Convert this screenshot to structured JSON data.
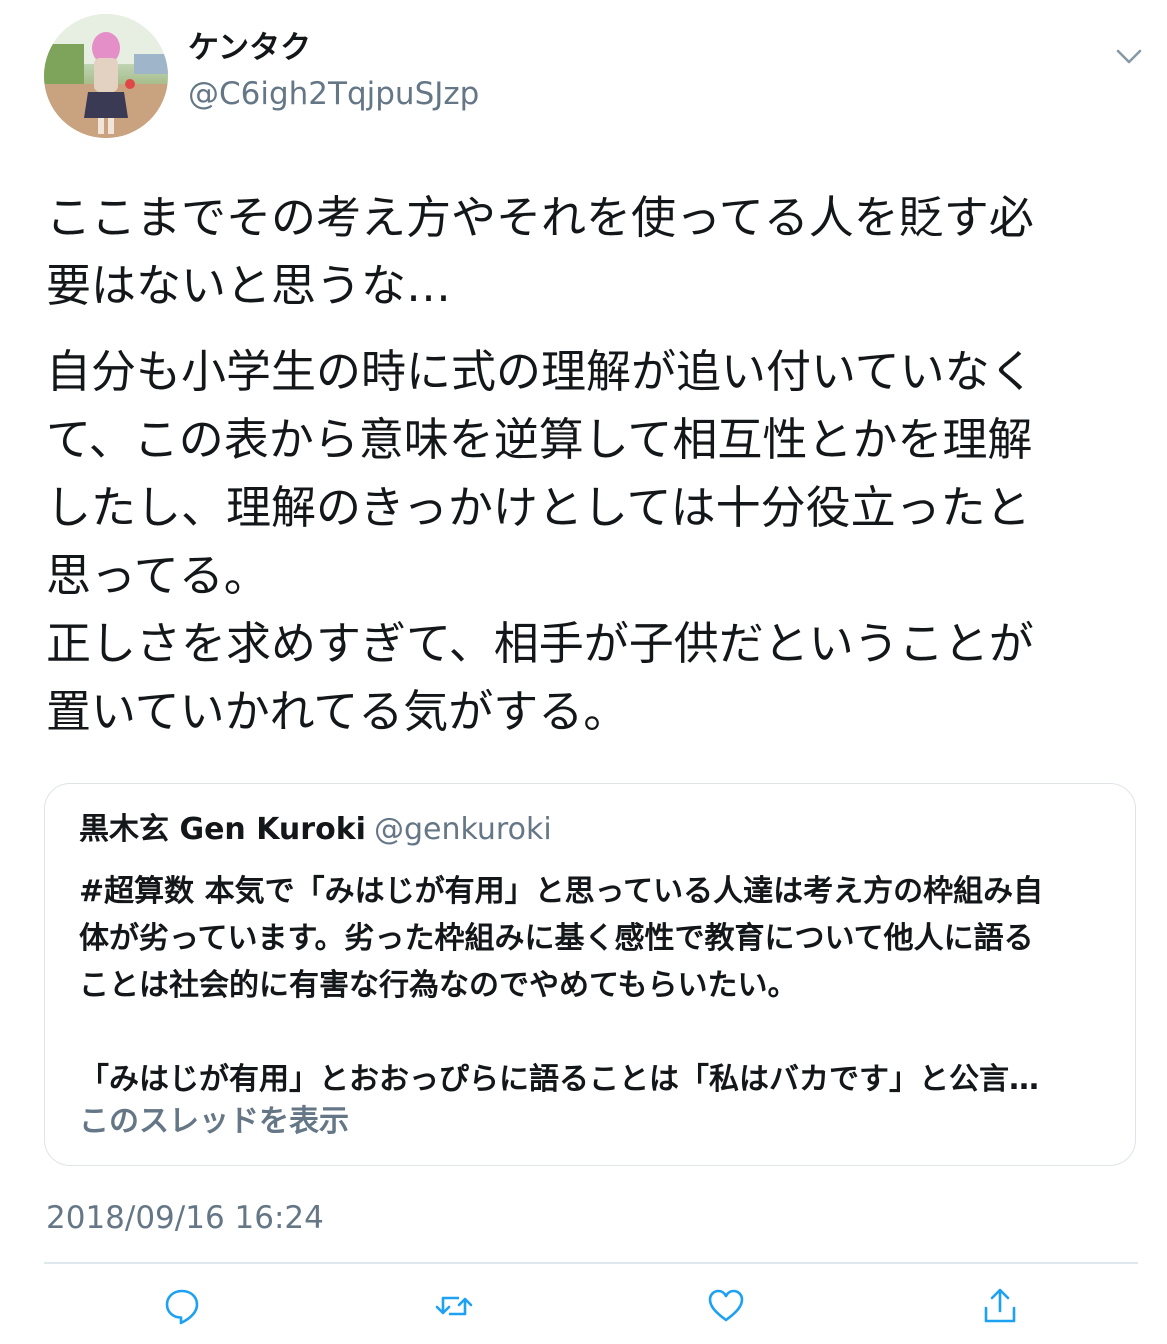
{
  "tweet": {
    "author": {
      "display_name": "ケンタク",
      "handle": "@C6igh2TqjpuSJzp"
    },
    "body_paragraphs": [
      "ここまでその考え方やそれを使ってる人を貶す必\n要はないと思うな…",
      "自分も小学生の時に式の理解が追い付いていなく\nて、この表から意味を逆算して相互性とかを理解\nしたし、理解のきっかけとしては十分役立ったと\n思ってる。\n正しさを求めすぎて、相手が子供だということが\n置いていかれてる気がする。"
    ],
    "timestamp": "2018/09/16 16:24"
  },
  "quoted_tweet": {
    "name": "黒木玄 Gen Kuroki",
    "handle": "@genkuroki",
    "text": "#超算数 本気で「みはじが有用」と思っている人達は考え方の枠組み自\n体が劣っています。劣った枠組みに基く感性で教育について他人に語る\nことは社会的に有害な行為なのでやめてもらいたい。\n\n「みはじが有用」とおおっぴらに語ることは「私はバカです」と公言…",
    "show_thread": "このスレッドを表示"
  },
  "icons": [
    "chevron-down-icon",
    "reply-icon",
    "retweet-icon",
    "like-icon",
    "share-icon"
  ],
  "colors": {
    "secondary_text": "#657786",
    "border": "#dfe4e8",
    "icon": "#1da1f2"
  }
}
